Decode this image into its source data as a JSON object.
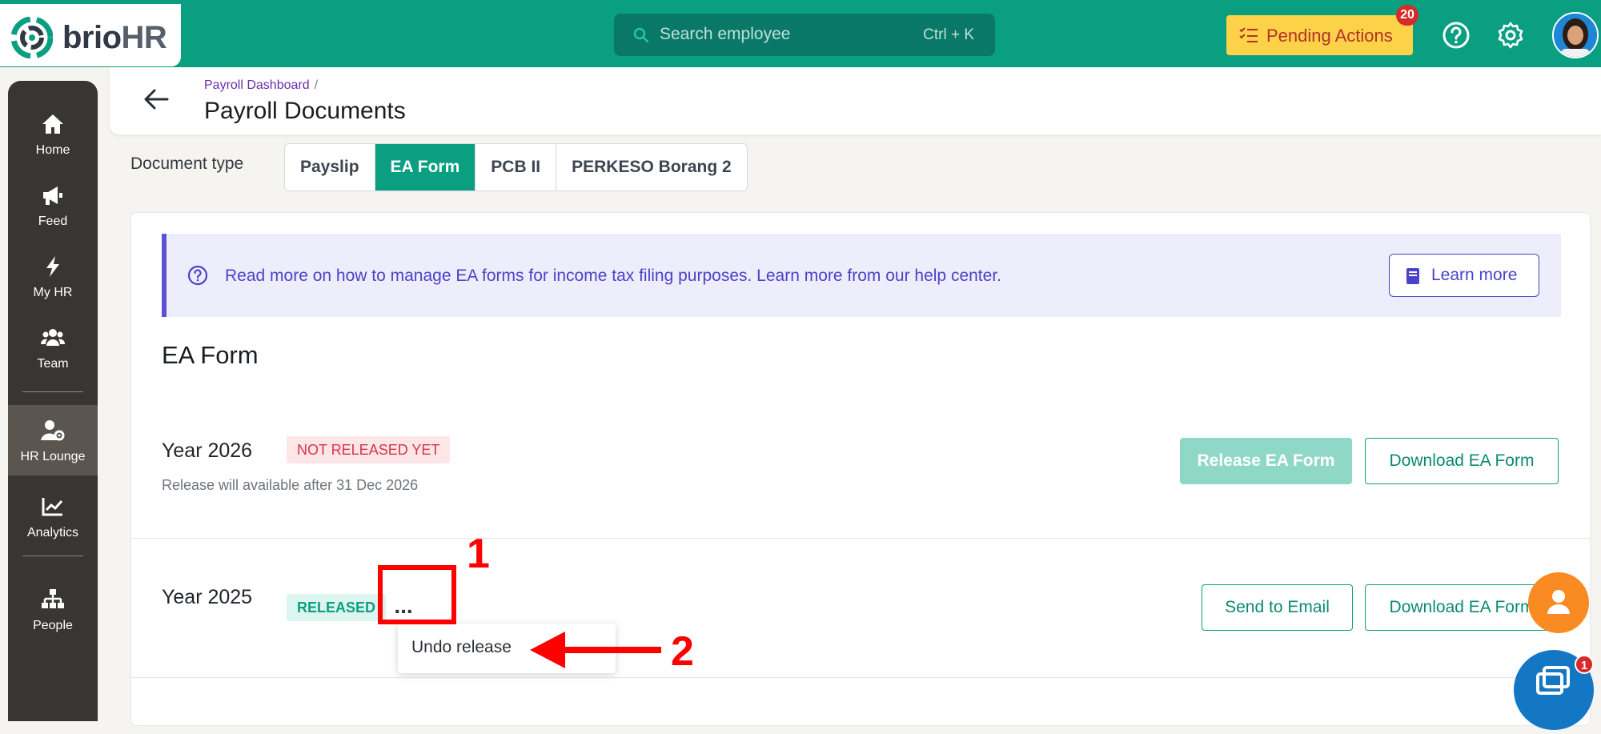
{
  "app": {
    "logo_main": "brio",
    "logo_suffix": "HR"
  },
  "topbar": {
    "search_placeholder": "Search employee",
    "search_shortcut": "Ctrl + K",
    "pending_label": "Pending Actions",
    "pending_count": "20",
    "help_icon": "help-circle-icon",
    "settings_icon": "gear-icon",
    "colors": {
      "bar": "#0b9f82",
      "pending": "#fcd249"
    }
  },
  "sidebar": {
    "items": [
      {
        "label": "Home",
        "icon": "home-icon"
      },
      {
        "label": "Feed",
        "icon": "megaphone-icon"
      },
      {
        "label": "My HR",
        "icon": "bolt-icon"
      },
      {
        "label": "Team",
        "icon": "team-icon"
      },
      {
        "label": "HR Lounge",
        "icon": "user-gear-icon",
        "active": true
      },
      {
        "label": "Analytics",
        "icon": "chart-line-icon"
      },
      {
        "label": "People",
        "icon": "org-chart-icon"
      }
    ]
  },
  "header": {
    "breadcrumb": "Payroll Dashboard",
    "breadcrumb_sep": "/",
    "title": "Payroll Documents"
  },
  "doctype": {
    "label": "Document type",
    "tabs": [
      "Payslip",
      "EA Form",
      "PCB II",
      "PERKESO Borang 2"
    ],
    "active": "EA Form"
  },
  "info": {
    "text": "Read more on how to manage EA forms for income tax filing purposes. Learn more from our help center.",
    "button": "Learn more"
  },
  "section_title": "EA Form",
  "years": [
    {
      "year": "Year 2026",
      "status": "NOT RELEASED YET",
      "note": "Release will available after 31 Dec 2026",
      "primary": "Release EA Form",
      "secondary": "Download EA Form"
    },
    {
      "year": "Year 2025",
      "status": "RELEASED",
      "more": "...",
      "primary": "Send to Email",
      "secondary": "Download EA Form"
    }
  ],
  "menu": {
    "undo": "Undo release"
  },
  "annotations": {
    "one": "1",
    "two": "2"
  },
  "chat_badge": "1"
}
